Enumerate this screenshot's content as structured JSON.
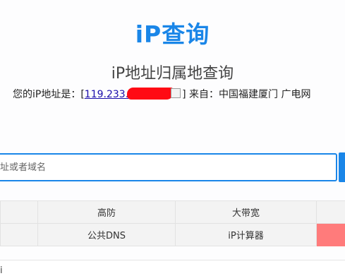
{
  "header": {
    "logo": "iP查询",
    "subtitle": "iP地址归属地查询"
  },
  "ip_info": {
    "prefix": "您的iP地址是：[",
    "ip": "119.233.",
    "suffix": "] 来自：中国福建厦门 广电网"
  },
  "search": {
    "placeholder": "址或者域名"
  },
  "links": {
    "row1": [
      "",
      "高防",
      "大带宽",
      ""
    ],
    "row2": [
      "",
      "公共DNS",
      "iP计算器",
      ""
    ]
  },
  "bottom": {
    "text": "i"
  },
  "colors": {
    "accent": "#1a86e8",
    "highlight_cell": "#ff7b7b",
    "redaction": "#ff0a14"
  }
}
